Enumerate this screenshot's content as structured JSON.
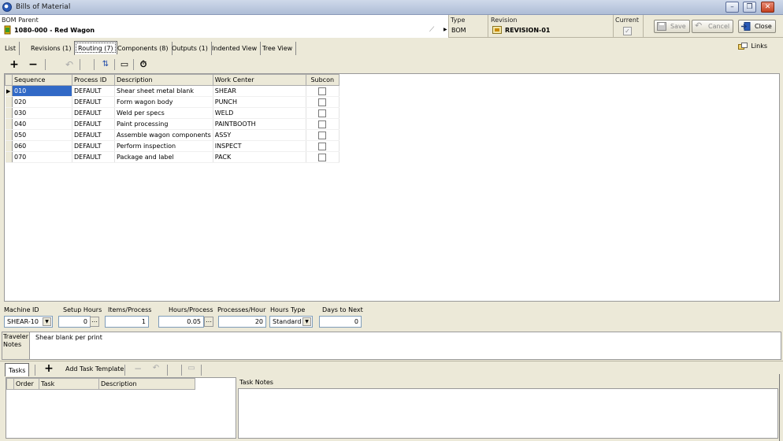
{
  "window": {
    "title": "Bills of Material",
    "minimize": "–",
    "restore": "❐",
    "close": "✕"
  },
  "header": {
    "bom_parent_label": "BOM Parent",
    "bom_parent_value": "1080-000 - Red Wagon",
    "type_label": "Type",
    "type_value": "BOM",
    "revision_label": "Revision",
    "revision_value": "REVISION-01",
    "current_label": "Current",
    "current_checked": true,
    "save_label": "Save",
    "cancel_label": "Cancel",
    "close_label": "Close"
  },
  "tabs": [
    {
      "label": "List"
    },
    {
      "label": "Revisions (1)"
    },
    {
      "label": "Routing (7)"
    },
    {
      "label": "Components (8)"
    },
    {
      "label": "Outputs (1)"
    },
    {
      "label": "Indented View"
    },
    {
      "label": "Tree View"
    }
  ],
  "active_tab": "Routing (7)",
  "links_label": "Links",
  "toolbar": {
    "add": "+",
    "remove": "−",
    "undo": "↶",
    "sort": "⇅",
    "window": "▭",
    "timer": "⏱"
  },
  "routing": {
    "columns": [
      "Sequence",
      "Process ID",
      "Description",
      "Work Center",
      "Subcon"
    ],
    "rows": [
      {
        "seq": "010",
        "process": "DEFAULT",
        "desc": "Shear sheet metal blank",
        "wc": "SHEAR",
        "subcon": false
      },
      {
        "seq": "020",
        "process": "DEFAULT",
        "desc": "Form wagon body",
        "wc": "PUNCH",
        "subcon": false
      },
      {
        "seq": "030",
        "process": "DEFAULT",
        "desc": "Weld per specs",
        "wc": "WELD",
        "subcon": false
      },
      {
        "seq": "040",
        "process": "DEFAULT",
        "desc": "Paint processing",
        "wc": "PAINTBOOTH",
        "subcon": false
      },
      {
        "seq": "050",
        "process": "DEFAULT",
        "desc": "Assemble wagon components",
        "wc": "ASSY",
        "subcon": false
      },
      {
        "seq": "060",
        "process": "DEFAULT",
        "desc": "Perform inspection",
        "wc": "INSPECT",
        "subcon": false
      },
      {
        "seq": "070",
        "process": "DEFAULT",
        "desc": "Package and label",
        "wc": "PACK",
        "subcon": false
      }
    ]
  },
  "detail": {
    "machine_id_label": "Machine ID",
    "machine_id_value": "SHEAR-10",
    "setup_hours_label": "Setup Hours",
    "setup_hours_value": "0",
    "items_process_label": "Items/Process",
    "items_process_value": "1",
    "hours_process_label": "Hours/Process",
    "hours_process_value": "0.05",
    "processes_hour_label": "Processes/Hour",
    "processes_hour_value": "20",
    "hours_type_label": "Hours Type",
    "hours_type_value": "Standard",
    "days_next_label": "Days to Next",
    "days_next_value": "0"
  },
  "traveler_notes": {
    "label_line1": "Traveler",
    "label_line2": "Notes",
    "value": "Shear blank per print"
  },
  "tasks": {
    "tab_label": "Tasks",
    "add_template_label": "Add Task Template",
    "columns": [
      "Order",
      "Task",
      "Description"
    ],
    "task_notes_label": "Task Notes"
  }
}
